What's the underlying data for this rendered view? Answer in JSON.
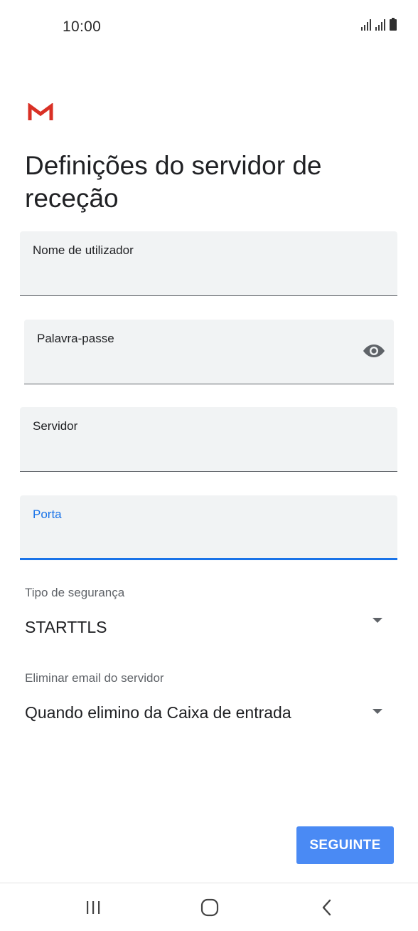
{
  "status_bar": {
    "time": "10:00",
    "icons": [
      "signal-icon",
      "signal-icon",
      "battery-icon"
    ]
  },
  "app": {
    "logo": "gmail-logo",
    "colors": {
      "accent": "#1a73e8",
      "button": "#4a8af4",
      "field_bg": "#f1f3f4",
      "logo_red": "#d93025"
    }
  },
  "page": {
    "title": "Definições do servidor de receção"
  },
  "form": {
    "username": {
      "label": "Nome de utilizador",
      "value": ""
    },
    "password": {
      "label": "Palavra-passe",
      "value": "",
      "toggle_icon": "eye-icon"
    },
    "server": {
      "label": "Servidor",
      "value": ""
    },
    "port": {
      "label": "Porta",
      "value": "",
      "focused": true
    },
    "security_type": {
      "label": "Tipo de segurança",
      "value": "STARTTLS"
    },
    "delete_email": {
      "label": "Eliminar email do servidor",
      "value": "Quando elimino da Caixa de entrada"
    }
  },
  "actions": {
    "next_label": "SEGUINTE"
  },
  "nav_bar": {
    "buttons": [
      "recent-apps-icon",
      "home-icon",
      "back-icon"
    ]
  }
}
